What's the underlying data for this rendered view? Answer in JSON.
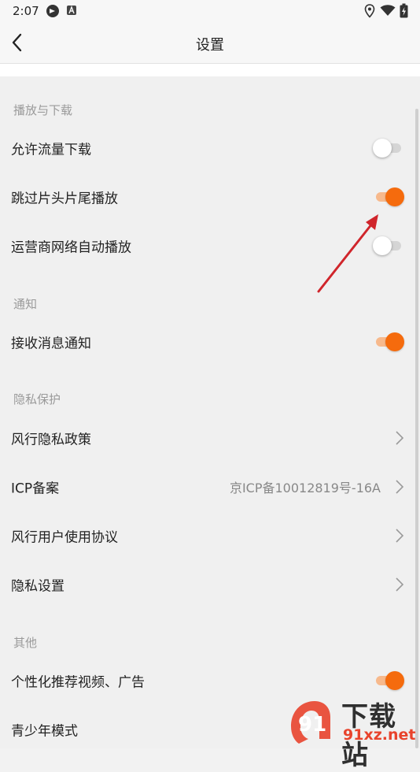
{
  "status_bar": {
    "time": "2:07"
  },
  "header": {
    "title": "设置"
  },
  "sections": {
    "playback": {
      "title": "播放与下载",
      "rows": [
        {
          "label": "允许流量下载",
          "enabled": false
        },
        {
          "label": "跳过片头片尾播放",
          "enabled": true
        },
        {
          "label": "运营商网络自动播放",
          "enabled": false
        }
      ]
    },
    "notify": {
      "title": "通知",
      "rows": [
        {
          "label": "接收消息通知",
          "enabled": true
        }
      ]
    },
    "privacy": {
      "title": "隐私保护",
      "rows": [
        {
          "label": "风行隐私政策"
        },
        {
          "label": "ICP备案",
          "value": "京ICP备10012819号-16A"
        },
        {
          "label": "风行用户使用协议"
        },
        {
          "label": "隐私设置"
        }
      ]
    },
    "other": {
      "title": "其他",
      "rows": [
        {
          "label": "个性化推荐视频、广告",
          "enabled": true
        },
        {
          "label": "青少年模式"
        }
      ]
    }
  },
  "colors": {
    "accent": "#f56b0d",
    "accent_track": "#f7b98c",
    "off_track": "#d5d5d5",
    "annotation_arrow": "#d0252b"
  },
  "watermark": {
    "logo_text": "91",
    "brand": "下载站",
    "url": "91xz.net"
  }
}
